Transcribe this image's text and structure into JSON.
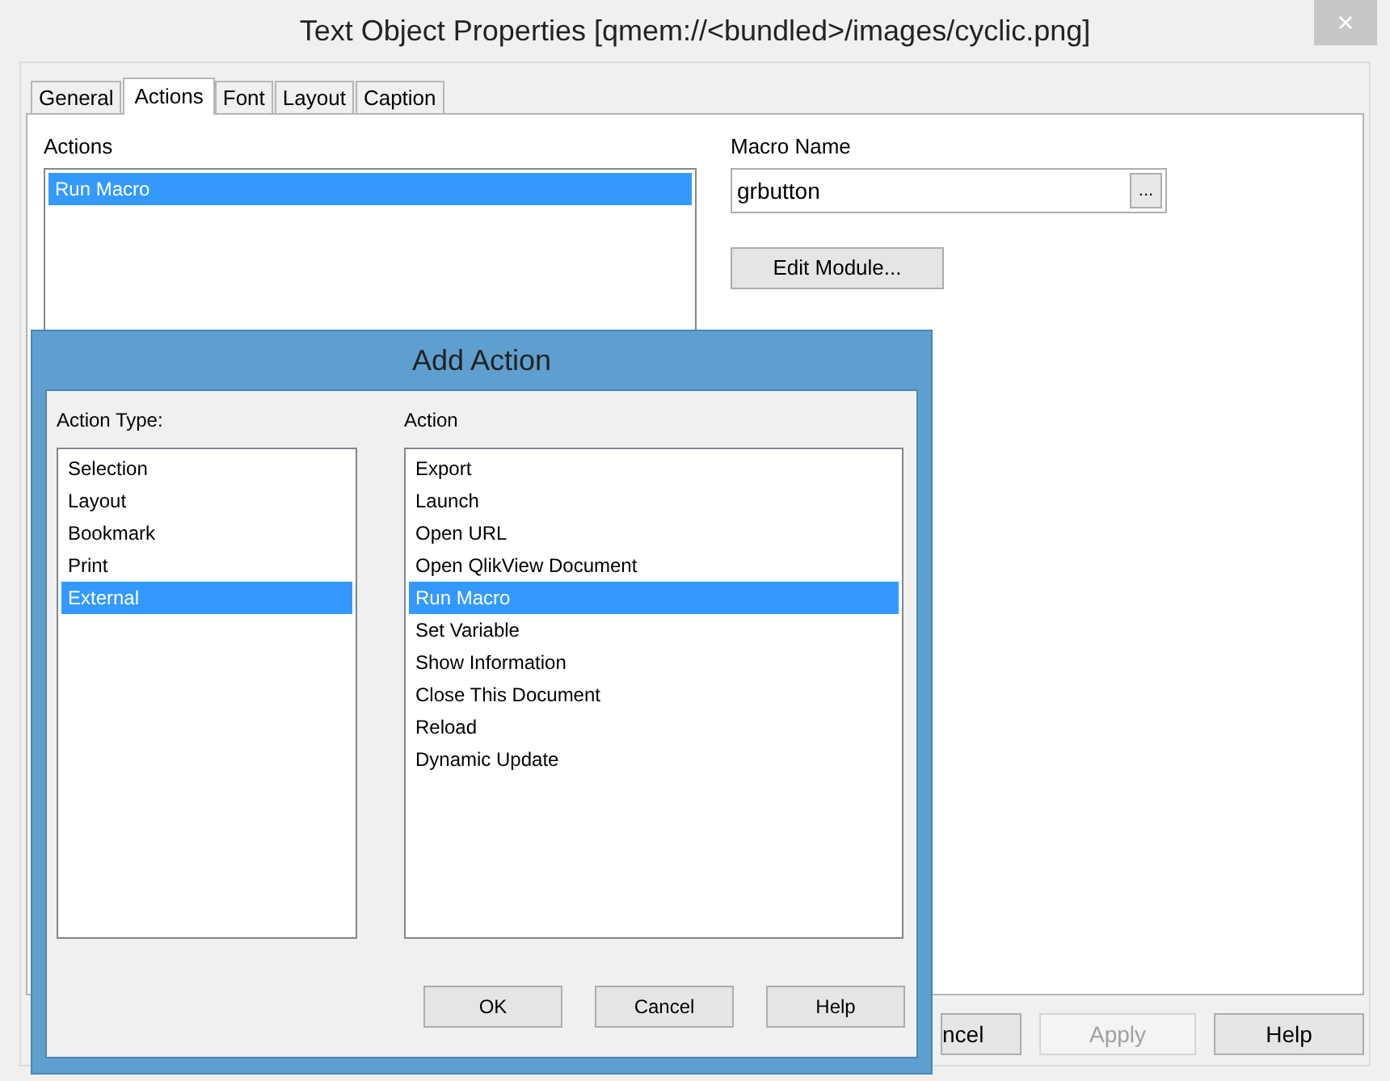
{
  "window": {
    "title": "Text Object Properties [qmem://<bundled>/images/cyclic.png]",
    "close": "×"
  },
  "tabs": [
    {
      "label": "General",
      "selected": false
    },
    {
      "label": "Actions",
      "selected": true
    },
    {
      "label": "Font",
      "selected": false
    },
    {
      "label": "Layout",
      "selected": false
    },
    {
      "label": "Caption",
      "selected": false
    }
  ],
  "actions": {
    "label": "Actions",
    "items": [
      {
        "label": "Run Macro",
        "selected": true
      }
    ]
  },
  "macro": {
    "label": "Macro Name",
    "value": "grbutton",
    "browse": "...",
    "edit_button": "Edit Module..."
  },
  "buttons": [
    {
      "label": "ncel",
      "disabled": false
    },
    {
      "label": "Apply",
      "disabled": true
    },
    {
      "label": "Help",
      "disabled": false
    }
  ],
  "add_action": {
    "title": "Add Action",
    "type_label": "Action Type:",
    "action_label": "Action",
    "types": [
      {
        "label": "Selection",
        "selected": false
      },
      {
        "label": "Layout",
        "selected": false
      },
      {
        "label": "Bookmark",
        "selected": false
      },
      {
        "label": "Print",
        "selected": false
      },
      {
        "label": "External",
        "selected": true
      }
    ],
    "actions": [
      {
        "label": "Export",
        "selected": false
      },
      {
        "label": "Launch",
        "selected": false
      },
      {
        "label": "Open URL",
        "selected": false
      },
      {
        "label": "Open QlikView Document",
        "selected": false
      },
      {
        "label": "Run Macro",
        "selected": true
      },
      {
        "label": "Set Variable",
        "selected": false
      },
      {
        "label": "Show Information",
        "selected": false
      },
      {
        "label": "Close This Document",
        "selected": false
      },
      {
        "label": "Reload",
        "selected": false
      },
      {
        "label": "Dynamic Update",
        "selected": false
      }
    ],
    "buttons": [
      "OK",
      "Cancel",
      "Help"
    ]
  }
}
